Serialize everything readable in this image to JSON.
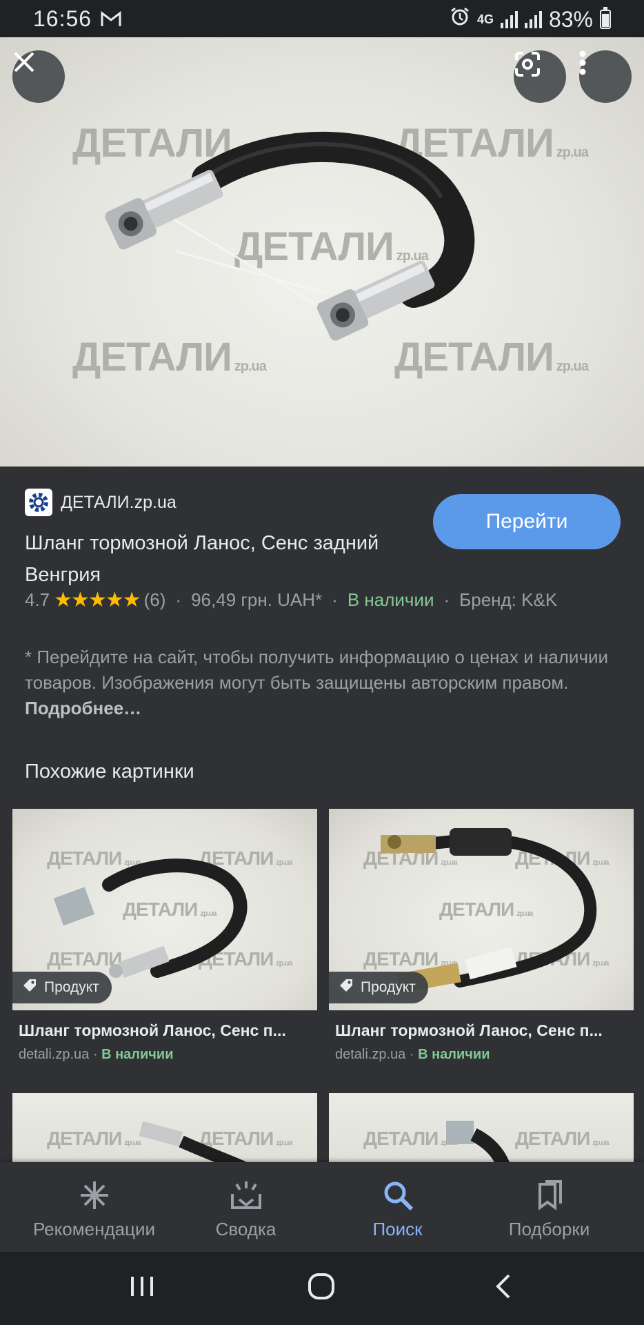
{
  "status_bar": {
    "time": "16:56",
    "network": "4G",
    "battery": "83%"
  },
  "hero": {
    "watermark_brand": "ДЕТАЛИ",
    "watermark_domain": "zp.ua"
  },
  "result": {
    "site_name": "ДЕТАЛИ.zp.ua",
    "go_button": "Перейти",
    "title": "Шланг тормозной Ланос, Сенс задний Венгрия",
    "rating": "4.7",
    "rating_stars": 4.7,
    "rating_count": "(6)",
    "price": "96,49 грн. UAH*",
    "availability": "В наличии",
    "brand": "Бренд: K&K",
    "note_text": "* Перейдите на сайт, чтобы получить информацию о ценах и наличии товаров. Изображения могут быть защищены авторским правом.",
    "note_link": "Подробнее…",
    "separator": "·"
  },
  "similar": {
    "heading": "Похожие картинки",
    "items": [
      {
        "chip": "Продукт",
        "title": "Шланг тормозной Ланос, Сенс п...",
        "domain": "detali.zp.ua",
        "availability": "В наличии"
      },
      {
        "chip": "Продукт",
        "title": "Шланг тормозной Ланос, Сенс п...",
        "domain": "detali.zp.ua",
        "availability": "В наличии"
      }
    ],
    "meta_separator": " · "
  },
  "bottom_nav": {
    "items": [
      {
        "label": "Рекомендации",
        "icon": "asterisk-icon"
      },
      {
        "label": "Сводка",
        "icon": "summary-icon"
      },
      {
        "label": "Поиск",
        "icon": "search-icon",
        "active": true
      },
      {
        "label": "Подборки",
        "icon": "collections-icon"
      }
    ]
  },
  "colors": {
    "accent": "#5b9ae9",
    "active_nav": "#8ab4f8",
    "in_stock": "#81c995",
    "stars": "#fbbc04",
    "background": "#303134"
  }
}
